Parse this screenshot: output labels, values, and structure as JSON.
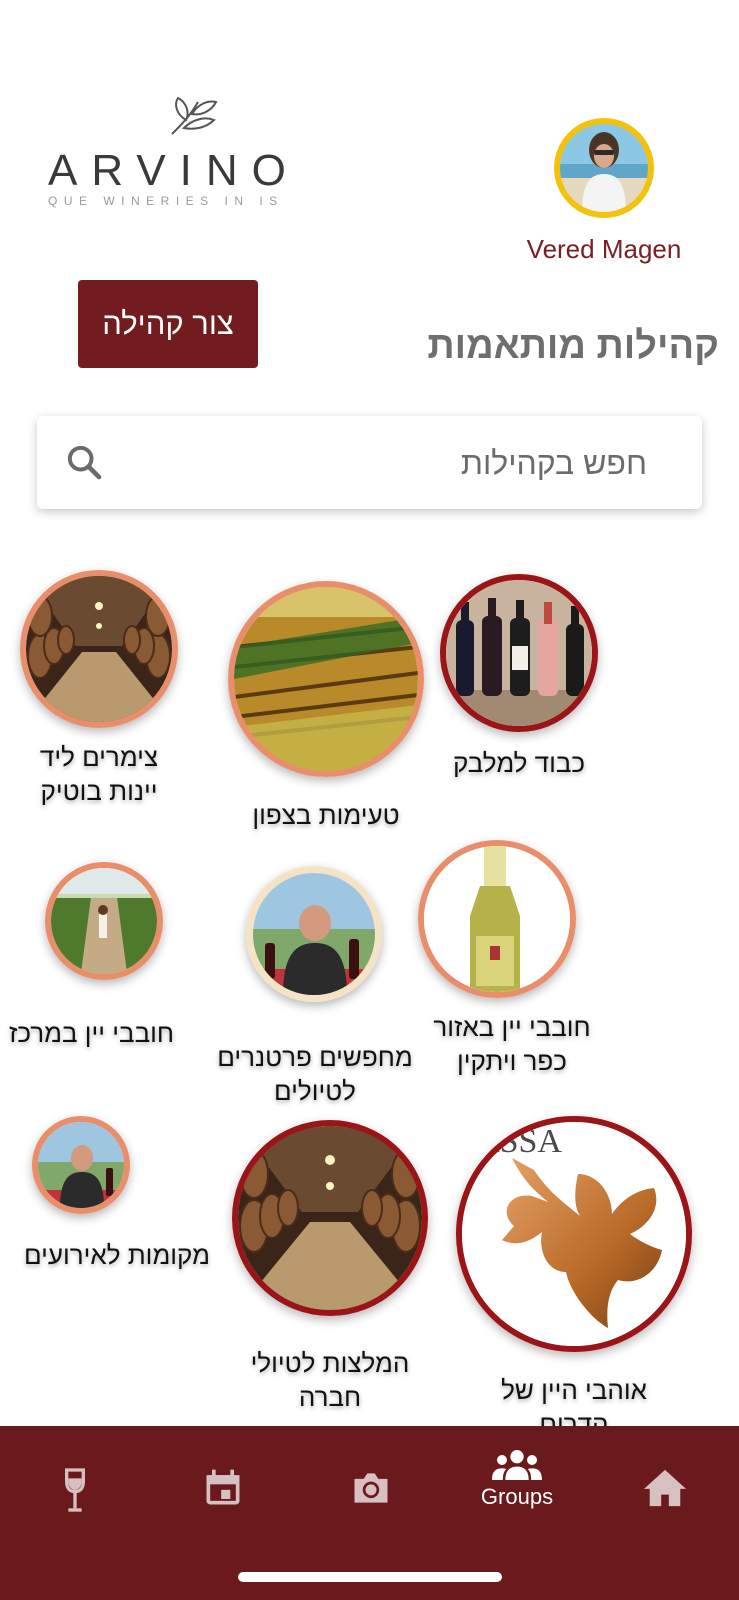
{
  "header": {
    "logo_text": "ARVINO",
    "logo_tagline": "QUE WINERIES IN IS",
    "user_name": "Vered Magen"
  },
  "toolbar": {
    "create_label": "צור קהילה",
    "title": "קהילות מותאמות"
  },
  "search": {
    "placeholder": "חפש בקהילות"
  },
  "communities": [
    {
      "label": "צימרים ליד יינות בוטיק",
      "image": "barrel-cellar",
      "ring_color": "#e98e6a"
    },
    {
      "label": "טעימות בצפון",
      "image": "vineyard-field",
      "ring_color": "#e98e6a"
    },
    {
      "label": "כבוד למלבק",
      "image": "wine-bottles",
      "ring_color": "#9a1418"
    },
    {
      "label": "חובבי יין במרכז",
      "image": "vineyard-path",
      "ring_color": "#e98e6a"
    },
    {
      "label": "מחפשים פרטנרים לטיולים",
      "image": "man-with-wine",
      "ring_color": "#f5e3c6"
    },
    {
      "label": "חובבי יין באזור כפר ויתקין",
      "image": "white-wine-bottle",
      "ring_color": "#e98e6a"
    },
    {
      "label": "מקומות לאירועים",
      "image": "man-with-wine",
      "ring_color": "#e98e6a"
    },
    {
      "label": "המלצות לטיולי חברה",
      "image": "barrel-cellar",
      "ring_color": "#9a1418"
    },
    {
      "label": "אוהבי היין של הדרום",
      "image": "vine-leaf-logo",
      "ring_color": "#9a1418"
    }
  ],
  "assaf_logo_text": "ASSA",
  "bottom_nav": {
    "items": [
      {
        "icon": "wine-glass-icon",
        "label": ""
      },
      {
        "icon": "calendar-icon",
        "label": ""
      },
      {
        "icon": "camera-icon",
        "label": ""
      },
      {
        "icon": "groups-icon",
        "label": "Groups"
      },
      {
        "icon": "home-icon",
        "label": ""
      }
    ]
  },
  "colors": {
    "brand": "#6a1a1d",
    "button": "#731c1f",
    "accent_salmon": "#e98e6a",
    "accent_red": "#9a1418",
    "avatar_ring": "#f4c20d"
  }
}
